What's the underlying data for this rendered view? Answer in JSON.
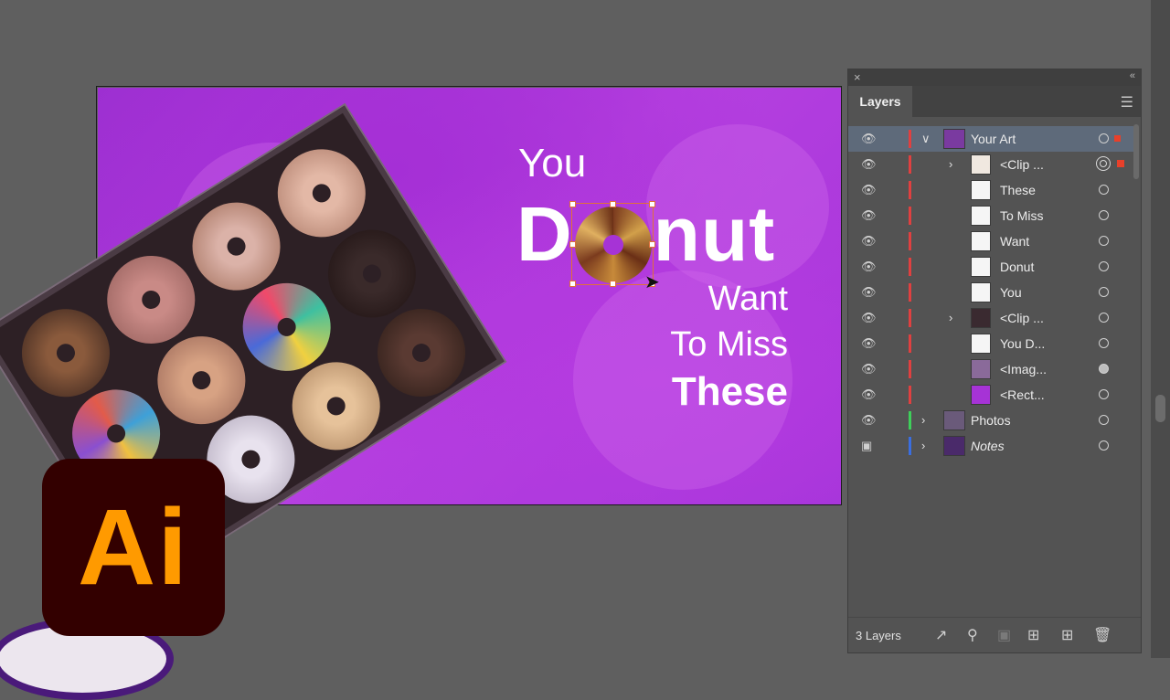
{
  "artboard": {
    "line1": "You",
    "line2a": "D",
    "line2b": "nut",
    "line3": "Want",
    "line4": "To Miss",
    "line5": "These"
  },
  "logo": {
    "text": "Ai"
  },
  "panel": {
    "tab": "Layers",
    "layer_count": "3 Layers",
    "rows": [
      {
        "name": "Your Art",
        "color": "#e04040"
      },
      {
        "name": "<Clip ..."
      },
      {
        "name": "These"
      },
      {
        "name": "To Miss"
      },
      {
        "name": "Want"
      },
      {
        "name": "Donut"
      },
      {
        "name": "You"
      },
      {
        "name": "<Clip ..."
      },
      {
        "name": "You D..."
      },
      {
        "name": "<Imag..."
      },
      {
        "name": "<Rect..."
      },
      {
        "name": "Photos",
        "color": "#3ecf5a"
      },
      {
        "name": "Notes",
        "color": "#3a6ee0"
      }
    ]
  },
  "colors": {
    "artboard_purple": "#a633d6",
    "ai_logo_bg": "#330000",
    "ai_logo_fg": "#ff9a00",
    "selection_red": "#e8402a"
  }
}
